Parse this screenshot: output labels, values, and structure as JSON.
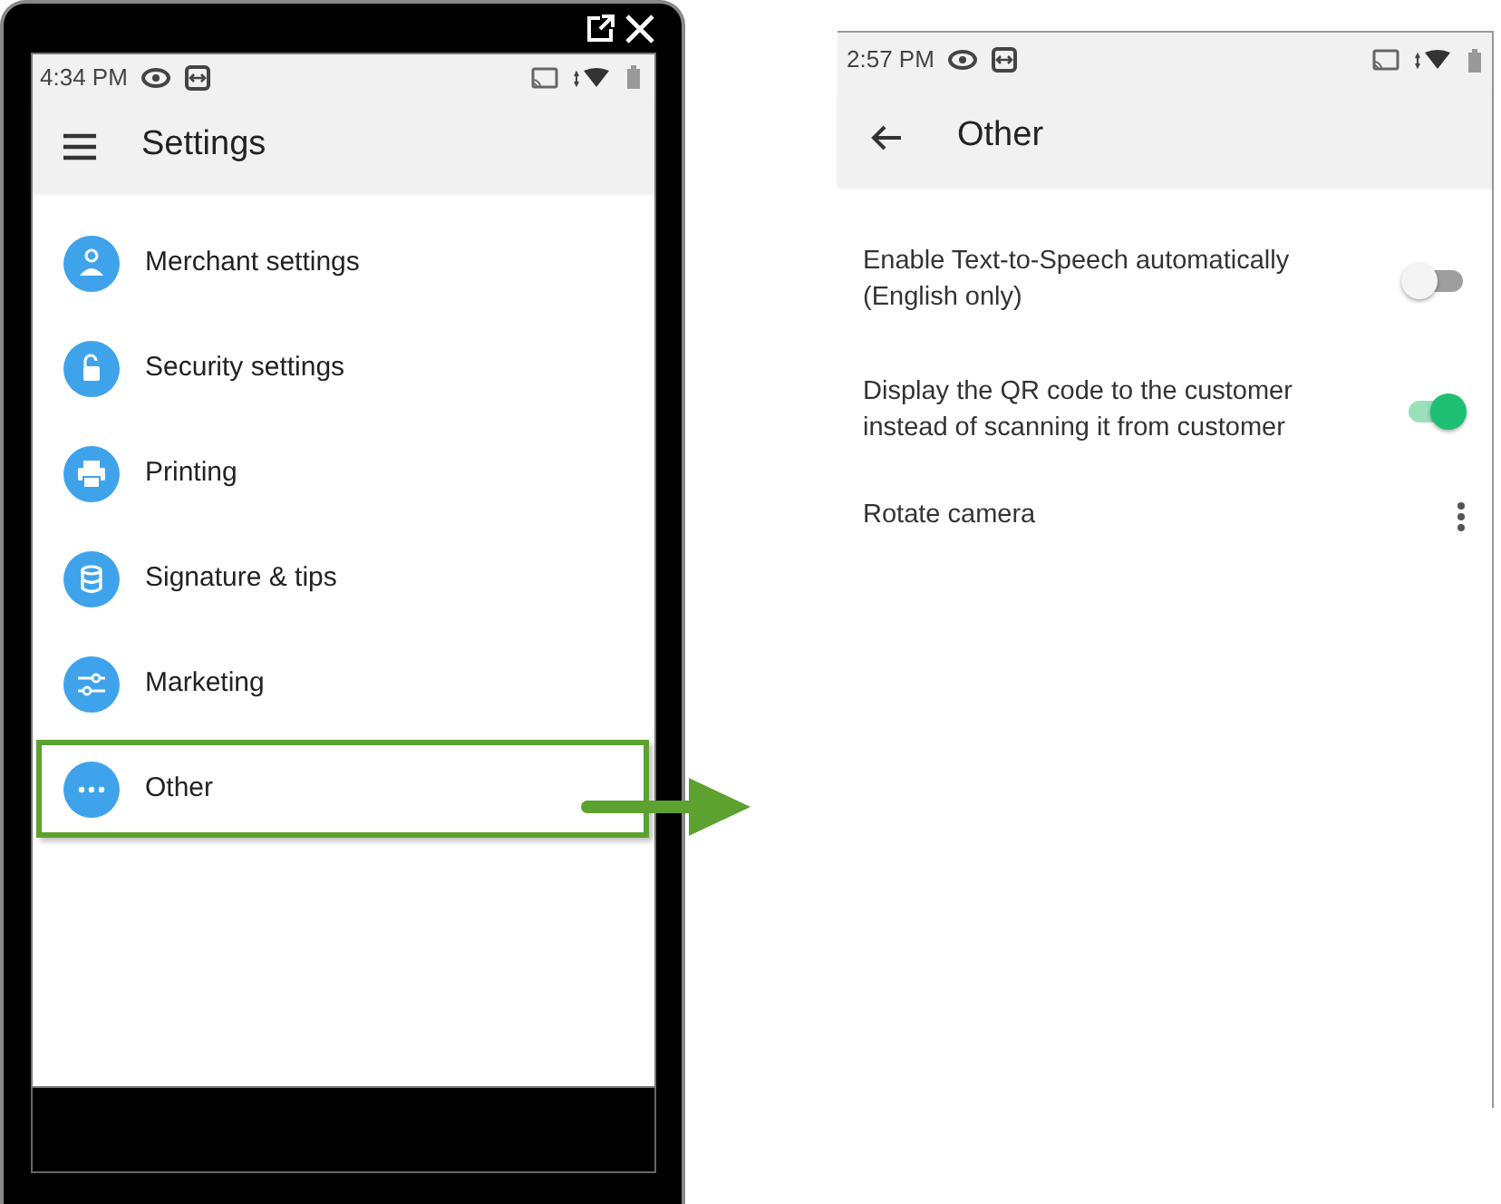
{
  "left_phone": {
    "status_bar": {
      "time": "4:34 PM"
    },
    "toolbar": {
      "title": "Settings"
    },
    "menu_items": [
      {
        "label": "Merchant settings",
        "highlighted": false
      },
      {
        "label": "Security settings",
        "highlighted": false
      },
      {
        "label": "Printing",
        "highlighted": false
      },
      {
        "label": "Signature & tips",
        "highlighted": false
      },
      {
        "label": "Marketing",
        "highlighted": false
      },
      {
        "label": "Other",
        "highlighted": true
      }
    ]
  },
  "right_phone": {
    "status_bar": {
      "time": "2:57 PM"
    },
    "toolbar": {
      "title": "Other"
    },
    "settings": [
      {
        "kind": "toggle",
        "label": "Enable Text-to-Speech automatically\n(English only)",
        "on": false
      },
      {
        "kind": "toggle",
        "label": "Display the QR code to the customer\ninstead of scanning it from customer",
        "on": true
      },
      {
        "kind": "menu",
        "label": "Rotate camera"
      }
    ]
  }
}
